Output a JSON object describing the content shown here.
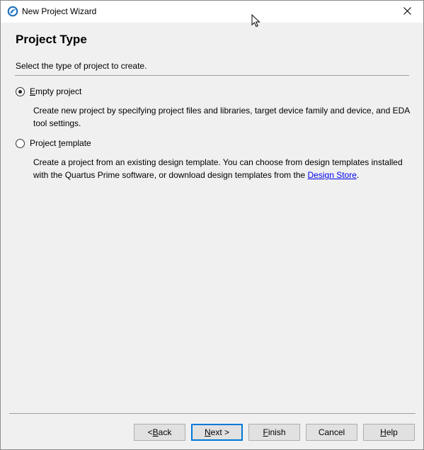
{
  "window": {
    "title": "New Project Wizard"
  },
  "page": {
    "title": "Project Type",
    "description": "Select the type of project to create."
  },
  "options": {
    "empty": {
      "label_prefix": "",
      "label_accel": "E",
      "label_rest": "mpty project",
      "checked": true,
      "description": "Create new project by specifying project files and libraries, target device family and device, and EDA tool settings."
    },
    "template": {
      "label_prefix": "Project ",
      "label_accel": "t",
      "label_rest": "emplate",
      "checked": false,
      "description_before": "Create a project from an existing design template. You can choose from design templates installed with the Quartus Prime software, or download design templates from the ",
      "link_text": "Design Store",
      "description_after": "."
    }
  },
  "buttons": {
    "back": {
      "prefix": "< ",
      "accel": "B",
      "rest": "ack"
    },
    "next": {
      "prefix": "",
      "accel": "N",
      "rest": "ext >"
    },
    "finish": {
      "prefix": "",
      "accel": "F",
      "rest": "inish"
    },
    "cancel": {
      "label": "Cancel"
    },
    "help": {
      "prefix": "",
      "accel": "H",
      "rest": "elp"
    }
  },
  "icons": {
    "app": "quartus-globe-icon",
    "close": "close-icon",
    "cursor": "mouse-pointer-icon"
  },
  "colors": {
    "default_button_border": "#0078d7",
    "link": "#0000ee",
    "dialog_bg": "#f0f0f0"
  }
}
